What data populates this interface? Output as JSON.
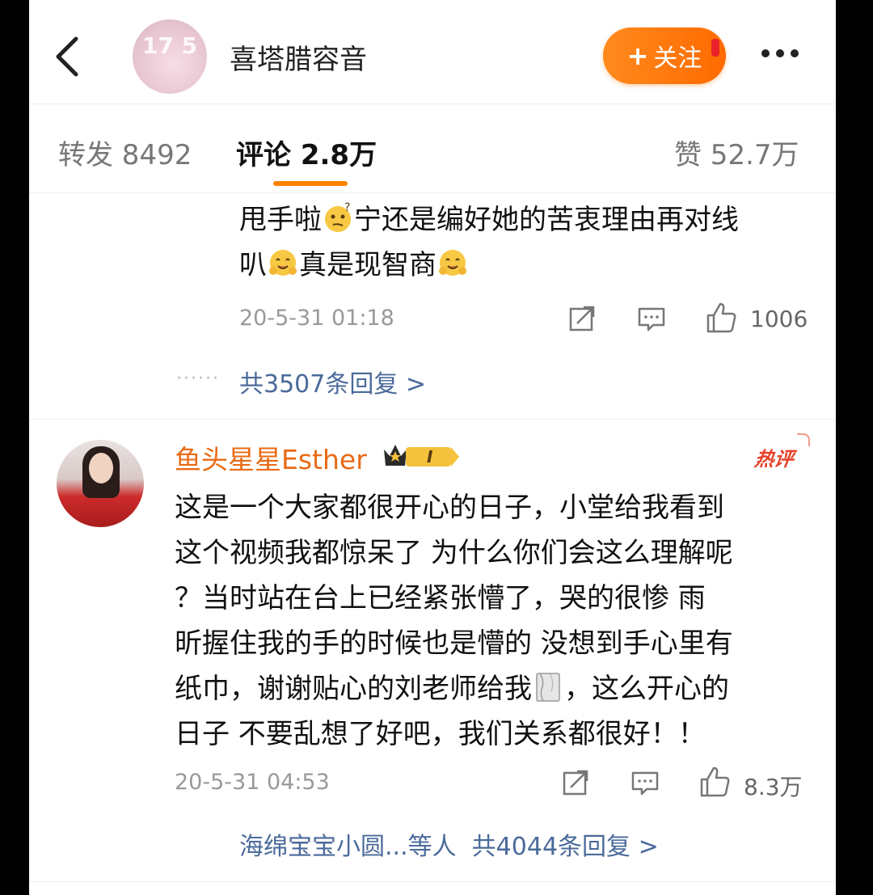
{
  "header": {
    "avatar_overlay": "17 5",
    "title": "喜塔腊容音",
    "follow_label": "关注",
    "follow_plus": "+"
  },
  "tabs": [
    {
      "label": "转发 8492"
    },
    {
      "label": "评论 2.8万"
    },
    {
      "label": "赞 52.7万"
    }
  ],
  "comment1": {
    "line1_a": "甩手啦",
    "line1_b": "宁还是编好她的苦衷理由再对线",
    "line2_a": "叭",
    "line2_b": "真是现智商",
    "time": "20-5-31 01:18",
    "likes": "1006",
    "replies": "共3507条回复 >",
    "dots": "······"
  },
  "comment2": {
    "name": "鱼头星星Esther",
    "badge_level": "I",
    "hot_label": "热评",
    "lines": [
      "这是一个大家都很开心的日子，小堂给我看到",
      "这个视频我都惊呆了 为什么你们会这么理解呢",
      "？当时站在台上已经紧张懵了，哭的很惨 雨",
      "昕握住我的手的时候也是懵的 没想到手心里有",
      "纸巾，谢谢贴心的刘老师给我",
      "，这么开心的",
      "日子 不要乱想了好吧，我们关系都很好！！"
    ],
    "time": "20-5-31 04:53",
    "likes": "8.3万",
    "replies": "海绵宝宝小圆...等人  共4044条回复 >"
  },
  "colors": {
    "accent": "#ff8200",
    "name": "#e86a14",
    "link": "#4a6a9a",
    "hot": "#e8412a"
  }
}
